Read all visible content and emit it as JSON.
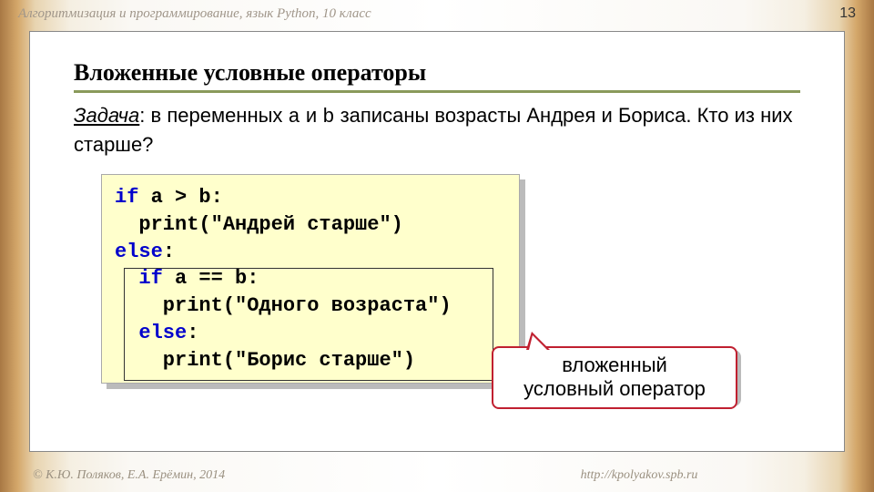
{
  "header": {
    "title": "Алгоритмизация и программирование, язык Python, 10 класс",
    "page_number": "13"
  },
  "section_title": "Вложенные условные операторы",
  "task": {
    "label": "Задача",
    "text_before": ": в переменных ",
    "var_a": "a",
    "mid": " и ",
    "var_b": "b",
    "text_after": " записаны возрасты Андрея и Бориса. Кто из них старше?"
  },
  "code": {
    "l1a": "if",
    "l1b": " a > b:",
    "l2": "  print(\"Андрей старше\")",
    "l3a": "else",
    "l3b": ":",
    "l4a": "  if",
    "l4b": " a == b:",
    "l5": "    print(\"Одного возраста\")",
    "l6a": "  else",
    "l6b": ":",
    "l7": "    print(\"Борис старше\")"
  },
  "callout": {
    "line1": "вложенный",
    "line2": "условный оператор"
  },
  "footer": {
    "copyright": "© К.Ю. Поляков, Е.А. Ерёмин, 2014",
    "url": "http://kpolyakov.spb.ru"
  }
}
